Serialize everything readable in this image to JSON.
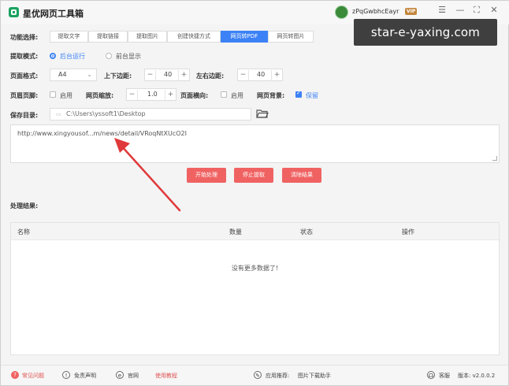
{
  "app": {
    "title": "星优网页工具箱"
  },
  "user": {
    "name": "zPqGwbhcEayr",
    "vip": "VIP"
  },
  "overlay": {
    "url": "star-e-yaxing.com"
  },
  "function": {
    "label": "功能选择:",
    "tabs": [
      "提取文字",
      "提取链接",
      "提取图片",
      "创建快捷方式",
      "网页转PDF",
      "网页转图片"
    ],
    "active_tab": "网页转PDF"
  },
  "mode": {
    "label": "提取模式:",
    "options": [
      "后台运行",
      "前台显示"
    ],
    "selected": "后台运行"
  },
  "page": {
    "format_label": "页面格式:",
    "format_value": "A4",
    "vmargin_label": "上下边距:",
    "vmargin_value": "40",
    "hmargin_label": "左右边距:",
    "hmargin_value": "40"
  },
  "header_footer": {
    "label": "页眉页脚:",
    "enable_text": "启用",
    "zoom_label": "网页缩放:",
    "zoom_value": "1.0",
    "landscape_label": "页面横向:",
    "landscape_text": "启用",
    "bg_label": "网页背景:",
    "bg_text": "保留"
  },
  "save": {
    "label": "保存目录:",
    "path": "C:\\Users\\yssoft1\\Desktop"
  },
  "url_input": {
    "value": "http://www.xingyousof...m/news/detail/VRoqNtXUcO2I"
  },
  "actions": {
    "start": "开始处理",
    "stop": "停止提取",
    "clear": "清除结果"
  },
  "results": {
    "label": "处理结果:",
    "columns": [
      "名称",
      "数量",
      "状态",
      "操作"
    ],
    "empty_text": "没有更多数据了!"
  },
  "footer": {
    "faq": "常见问题",
    "disclaimer": "免责声明",
    "website": "官网",
    "tutorial": "使用教程",
    "recommend_label": "应用推荐:",
    "recommend_app": "图片下载助手",
    "service": "客服",
    "version": "版本: v2.0.0.2"
  },
  "colors": {
    "accent": "#3c82f6",
    "danger": "#f06262",
    "logo": "#1aa260",
    "arrow": "#e0393b"
  }
}
